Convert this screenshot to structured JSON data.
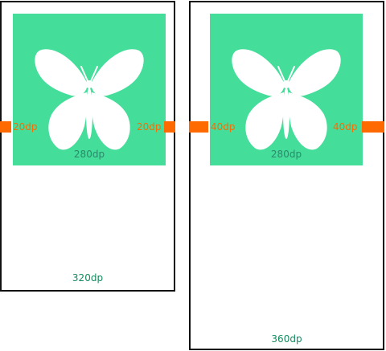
{
  "left_example": {
    "image_width": "280dp",
    "margin_left": "20dp",
    "margin_right": "20dp",
    "screen_width": "320dp"
  },
  "right_example": {
    "image_width": "280dp",
    "margin_left": "40dp",
    "margin_right": "40dp",
    "screen_width": "360dp"
  },
  "colors": {
    "image_background": "#44dd9a",
    "margin_marker": "#ff6a00",
    "screen_border": "#111111",
    "butterfly": "#ffffff"
  },
  "icons": {
    "image_content": "butterfly-icon"
  }
}
